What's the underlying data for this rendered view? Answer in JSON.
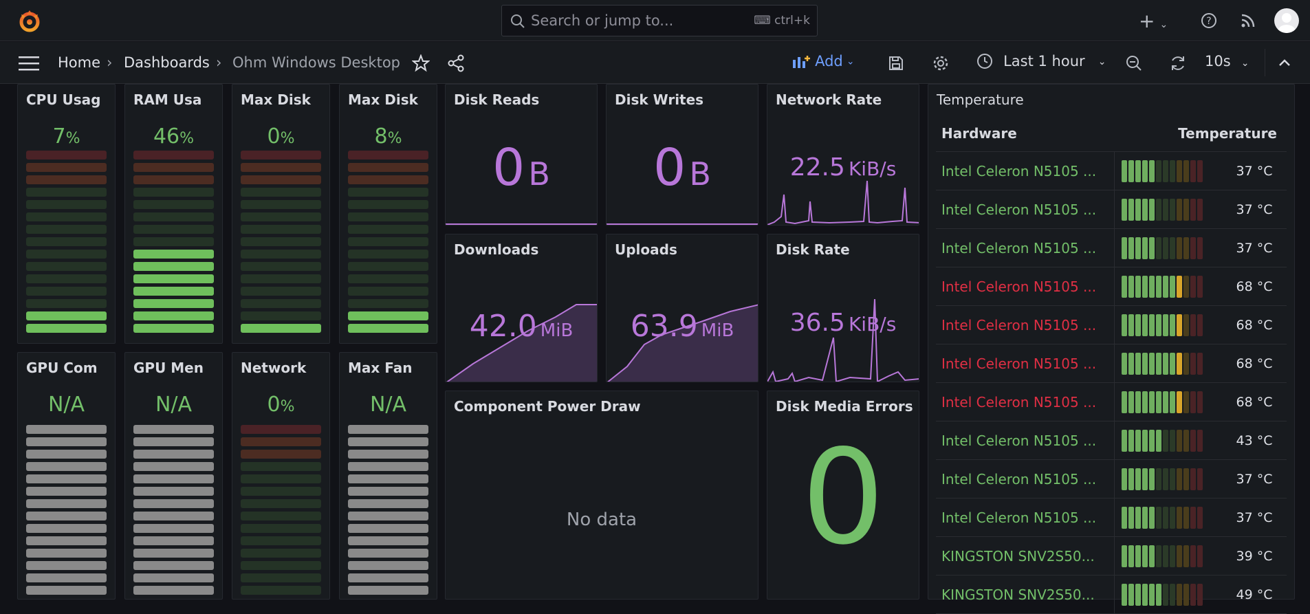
{
  "search": {
    "placeholder": "Search or jump to...",
    "shortcut": "ctrl+k"
  },
  "breadcrumb": {
    "home": "Home",
    "dashboards": "Dashboards",
    "current": "Ohm Windows Desktop"
  },
  "toolbar": {
    "add_label": "Add",
    "time_range": "Last 1 hour",
    "refresh_interval": "10s"
  },
  "gauges_row1": [
    {
      "title": "CPU Usag",
      "value": "7",
      "unit": "%",
      "lit": 2
    },
    {
      "title": "RAM Usa",
      "value": "46",
      "unit": "%",
      "lit": 7
    },
    {
      "title": "Max Disk",
      "value": "0",
      "unit": "%",
      "lit": 1
    },
    {
      "title": "Max Disk",
      "value": "8",
      "unit": "%",
      "lit": 2
    }
  ],
  "gauges_row2": [
    {
      "title": "GPU Com",
      "value": "N/A",
      "unit": "",
      "na": true
    },
    {
      "title": "GPU Men",
      "value": "N/A",
      "unit": "",
      "na": true
    },
    {
      "title": "Network",
      "value": "0",
      "unit": "%",
      "na": false
    },
    {
      "title": "Max Fan",
      "value": "N/A",
      "unit": "",
      "na": true
    }
  ],
  "stats": {
    "disk_reads": {
      "title": "Disk Reads",
      "value": "0",
      "unit": "B"
    },
    "disk_writes": {
      "title": "Disk Writes",
      "value": "0",
      "unit": "B"
    },
    "network_rate": {
      "title": "Network Rate",
      "value": "22.5",
      "unit": "KiB/s"
    },
    "downloads": {
      "title": "Downloads",
      "value": "42.0",
      "unit": "MiB"
    },
    "uploads": {
      "title": "Uploads",
      "value": "63.9",
      "unit": "MiB"
    },
    "disk_rate": {
      "title": "Disk Rate",
      "value": "36.5",
      "unit": "KiB/s"
    },
    "power": {
      "title": "Component Power Draw",
      "nodata": "No data"
    },
    "media_errors": {
      "title": "Disk Media Errors",
      "value": "0"
    }
  },
  "temperature": {
    "title": "Temperature",
    "col_hardware": "Hardware",
    "col_temperature": "Temperature",
    "rows": [
      {
        "name": "Intel Celeron N5105 ...",
        "temp": "37 °C",
        "level": 5,
        "hot": false
      },
      {
        "name": "Intel Celeron N5105 ...",
        "temp": "37 °C",
        "level": 5,
        "hot": false
      },
      {
        "name": "Intel Celeron N5105 ...",
        "temp": "37 °C",
        "level": 5,
        "hot": false
      },
      {
        "name": "Intel Celeron N5105 ...",
        "temp": "68 °C",
        "level": 9,
        "hot": true
      },
      {
        "name": "Intel Celeron N5105 ...",
        "temp": "68 °C",
        "level": 9,
        "hot": true
      },
      {
        "name": "Intel Celeron N5105 ...",
        "temp": "68 °C",
        "level": 9,
        "hot": true
      },
      {
        "name": "Intel Celeron N5105 ...",
        "temp": "68 °C",
        "level": 9,
        "hot": true
      },
      {
        "name": "Intel Celeron N5105 ...",
        "temp": "43 °C",
        "level": 6,
        "hot": false
      },
      {
        "name": "Intel Celeron N5105 ...",
        "temp": "37 °C",
        "level": 5,
        "hot": false
      },
      {
        "name": "Intel Celeron N5105 ...",
        "temp": "37 °C",
        "level": 5,
        "hot": false
      },
      {
        "name": "KINGSTON SNV2S50...",
        "temp": "39 °C",
        "level": 5,
        "hot": false
      },
      {
        "name": "KINGSTON SNV2S50...",
        "temp": "49 °C",
        "level": 6,
        "hot": false
      }
    ]
  },
  "colors": {
    "green": "#73bf69",
    "purple": "#b877d9",
    "red": "#e02f44",
    "yellow": "#e0b400",
    "panel": "#181b1f"
  },
  "icons": [
    "grafana-logo-icon",
    "search-icon",
    "keyboard-icon",
    "plus-icon",
    "help-icon",
    "rss-icon",
    "avatar",
    "menu-icon",
    "star-icon",
    "share-icon",
    "save-icon",
    "gear-icon",
    "clock-icon",
    "zoom-out-icon",
    "refresh-icon",
    "chevron-up-icon"
  ]
}
